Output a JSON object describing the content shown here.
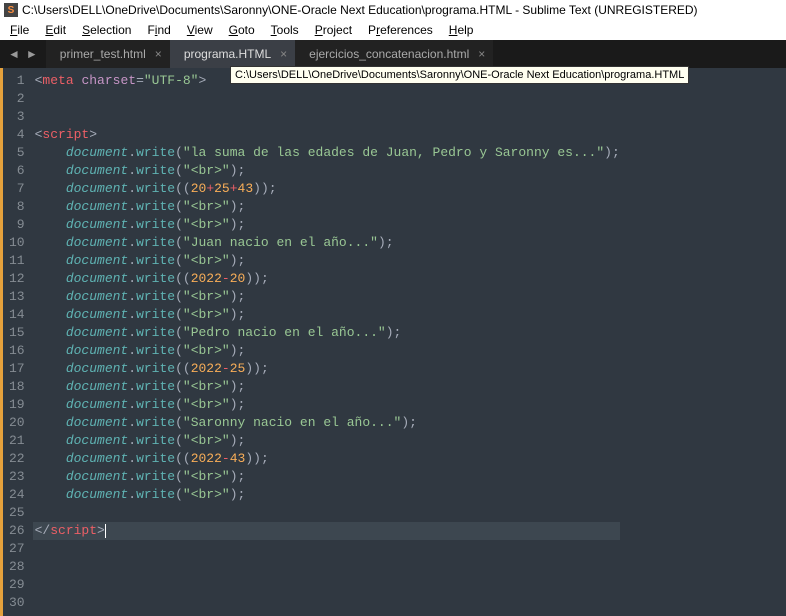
{
  "window": {
    "title": "C:\\Users\\DELL\\OneDrive\\Documents\\Saronny\\ONE-Oracle Next Education\\programa.HTML - Sublime Text (UNREGISTERED)",
    "app_icon_letter": "S"
  },
  "menu": {
    "file": "File",
    "edit": "Edit",
    "selection": "Selection",
    "find": "Find",
    "view": "View",
    "goto": "Goto",
    "tools": "Tools",
    "project": "Project",
    "preferences": "Preferences",
    "help": "Help"
  },
  "nav": {
    "back": "◄",
    "forward": "►"
  },
  "tabs": [
    {
      "label": "primer_test.html",
      "active": false
    },
    {
      "label": "programa.HTML",
      "active": true
    },
    {
      "label": "ejercicios_concatenacion.html",
      "active": false
    }
  ],
  "tab_close_glyph": "×",
  "tooltip": "C:\\Users\\DELL\\OneDrive\\Documents\\Saronny\\ONE-Oracle Next Education\\programa.HTML",
  "code": {
    "line_count": 30,
    "lines": [
      {
        "n": 1,
        "indent": 0,
        "type": "meta",
        "tag": "meta",
        "attr": "charset",
        "value": "\"UTF-8\""
      },
      {
        "n": 2,
        "indent": 0,
        "type": "blank"
      },
      {
        "n": 3,
        "indent": 0,
        "type": "blank"
      },
      {
        "n": 4,
        "indent": 0,
        "type": "open",
        "tag": "script"
      },
      {
        "n": 5,
        "indent": 1,
        "type": "call",
        "arg_kind": "str",
        "arg": "\"la suma de las edades de Juan, Pedro y Saronny es...\""
      },
      {
        "n": 6,
        "indent": 1,
        "type": "call",
        "arg_kind": "str",
        "arg": "\"<br>\""
      },
      {
        "n": 7,
        "indent": 1,
        "type": "call",
        "arg_kind": "sum3",
        "a": "20",
        "b": "25",
        "c": "43"
      },
      {
        "n": 8,
        "indent": 1,
        "type": "call",
        "arg_kind": "str",
        "arg": "\"<br>\""
      },
      {
        "n": 9,
        "indent": 1,
        "type": "call",
        "arg_kind": "str",
        "arg": "\"<br>\""
      },
      {
        "n": 10,
        "indent": 1,
        "type": "call",
        "arg_kind": "str",
        "arg": "\"Juan nacio en el año...\""
      },
      {
        "n": 11,
        "indent": 1,
        "type": "call",
        "arg_kind": "str",
        "arg": "\"<br>\""
      },
      {
        "n": 12,
        "indent": 1,
        "type": "call",
        "arg_kind": "sub",
        "a": "2022",
        "b": "20"
      },
      {
        "n": 13,
        "indent": 1,
        "type": "call",
        "arg_kind": "str",
        "arg": "\"<br>\""
      },
      {
        "n": 14,
        "indent": 1,
        "type": "call",
        "arg_kind": "str",
        "arg": "\"<br>\""
      },
      {
        "n": 15,
        "indent": 1,
        "type": "call",
        "arg_kind": "str",
        "arg": "\"Pedro nacio en el año...\""
      },
      {
        "n": 16,
        "indent": 1,
        "type": "call",
        "arg_kind": "str",
        "arg": "\"<br>\""
      },
      {
        "n": 17,
        "indent": 1,
        "type": "call",
        "arg_kind": "sub",
        "a": "2022",
        "b": "25"
      },
      {
        "n": 18,
        "indent": 1,
        "type": "call",
        "arg_kind": "str",
        "arg": "\"<br>\""
      },
      {
        "n": 19,
        "indent": 1,
        "type": "call",
        "arg_kind": "str",
        "arg": "\"<br>\""
      },
      {
        "n": 20,
        "indent": 1,
        "type": "call",
        "arg_kind": "str",
        "arg": "\"Saronny nacio en el año...\""
      },
      {
        "n": 21,
        "indent": 1,
        "type": "call",
        "arg_kind": "str",
        "arg": "\"<br>\""
      },
      {
        "n": 22,
        "indent": 1,
        "type": "call",
        "arg_kind": "sub",
        "a": "2022",
        "b": "43"
      },
      {
        "n": 23,
        "indent": 1,
        "type": "call",
        "arg_kind": "str",
        "arg": "\"<br>\""
      },
      {
        "n": 24,
        "indent": 1,
        "type": "call",
        "arg_kind": "str",
        "arg": "\"<br>\""
      },
      {
        "n": 25,
        "indent": 0,
        "type": "blank"
      },
      {
        "n": 26,
        "indent": 0,
        "type": "close",
        "tag": "script",
        "cursor": true,
        "highlight": true
      },
      {
        "n": 27,
        "indent": 0,
        "type": "blank"
      },
      {
        "n": 28,
        "indent": 0,
        "type": "blank"
      },
      {
        "n": 29,
        "indent": 0,
        "type": "blank"
      },
      {
        "n": 30,
        "indent": 0,
        "type": "blank"
      }
    ],
    "object": "document",
    "method": "write"
  }
}
